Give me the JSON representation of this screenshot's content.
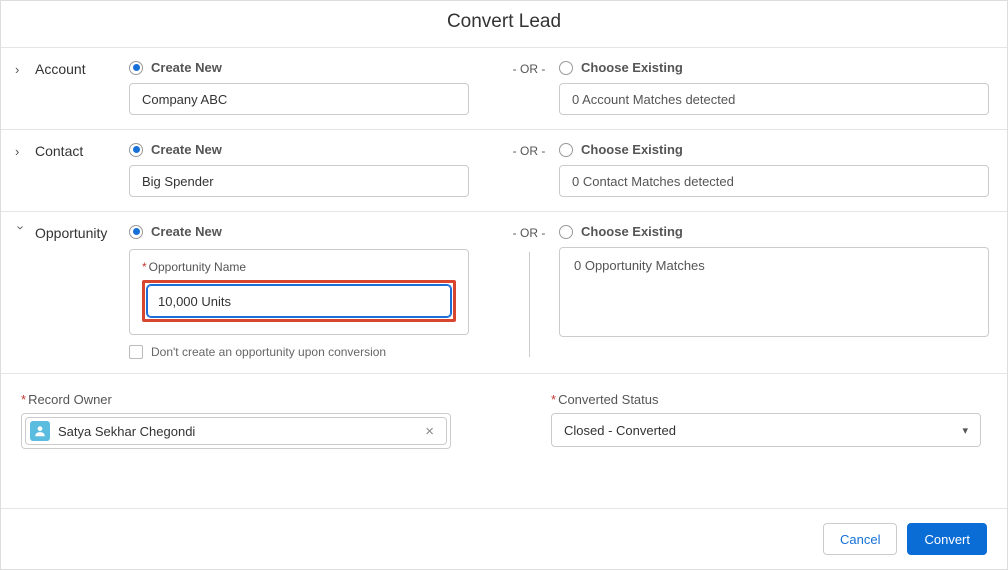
{
  "title": "Convert Lead",
  "orLabel": "- OR -",
  "createNewLabel": "Create New",
  "chooseExistingLabel": "Choose Existing",
  "account": {
    "section": "Account",
    "value": "Company ABC",
    "matches": "0 Account Matches detected"
  },
  "contact": {
    "section": "Contact",
    "value": "Big Spender",
    "matches": "0 Contact Matches detected"
  },
  "opportunity": {
    "section": "Opportunity",
    "nameLabel": "Opportunity Name",
    "nameValue": "10,000 Units",
    "dontCreateLabel": "Don't create an opportunity upon conversion",
    "matches": "0 Opportunity Matches"
  },
  "recordOwner": {
    "label": "Record Owner",
    "value": "Satya Sekhar Chegondi"
  },
  "convertedStatus": {
    "label": "Converted Status",
    "value": "Closed - Converted"
  },
  "buttons": {
    "cancel": "Cancel",
    "convert": "Convert"
  }
}
